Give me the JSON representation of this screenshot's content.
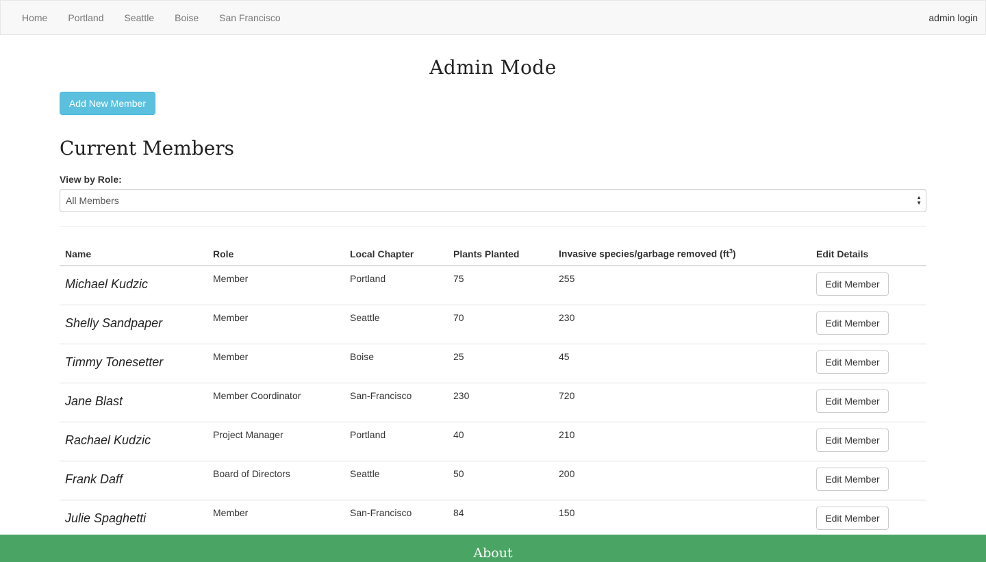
{
  "nav": {
    "links": [
      "Home",
      "Portland",
      "Seattle",
      "Boise",
      "San Francisco"
    ],
    "right_link": "admin login"
  },
  "page_title": "Admin Mode",
  "add_button": "Add New Member",
  "section_title": "Current Members",
  "filter": {
    "label": "View by Role:",
    "selected": "All Members"
  },
  "table": {
    "headers": {
      "name": "Name",
      "role": "Role",
      "chapter": "Local Chapter",
      "plants": "Plants Planted",
      "invasive_prefix": "Invasive species/garbage removed (ft",
      "invasive_sup": "3",
      "invasive_suffix": ")",
      "edit": "Edit Details"
    },
    "edit_label": "Edit Member",
    "rows": [
      {
        "name": "Michael Kudzic",
        "role": "Member",
        "chapter": "Portland",
        "plants": "75",
        "removed": "255"
      },
      {
        "name": "Shelly Sandpaper",
        "role": "Member",
        "chapter": "Seattle",
        "plants": "70",
        "removed": "230"
      },
      {
        "name": "Timmy Tonesetter",
        "role": "Member",
        "chapter": "Boise",
        "plants": "25",
        "removed": "45"
      },
      {
        "name": "Jane Blast",
        "role": "Member Coordinator",
        "chapter": "San-Francisco",
        "plants": "230",
        "removed": "720"
      },
      {
        "name": "Rachael Kudzic",
        "role": "Project Manager",
        "chapter": "Portland",
        "plants": "40",
        "removed": "210"
      },
      {
        "name": "Frank Daff",
        "role": "Board of Directors",
        "chapter": "Seattle",
        "plants": "50",
        "removed": "200"
      },
      {
        "name": "Julie Spaghetti",
        "role": "Member",
        "chapter": "San-Francisco",
        "plants": "84",
        "removed": "150"
      }
    ]
  },
  "footer": {
    "title": "About"
  },
  "colors": {
    "info_button": "#5bc0de",
    "footer_bg": "#4aa564",
    "navbar_bg": "#f8f8f8"
  }
}
